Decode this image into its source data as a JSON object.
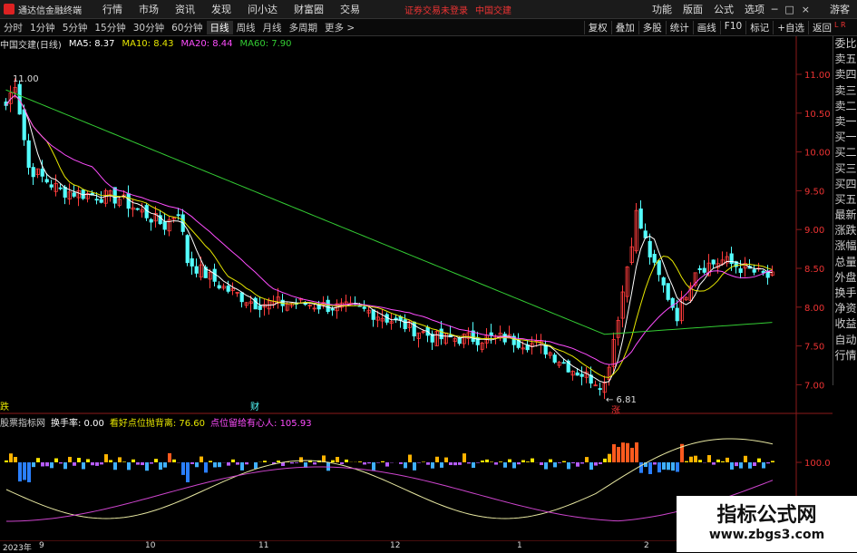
{
  "app": {
    "title": "通达信金融终端"
  },
  "menu": [
    "行情",
    "市场",
    "资讯",
    "发现",
    "问小达",
    "财富圈",
    "交易"
  ],
  "warning": "证券交易未登录",
  "stock_name_top": "中国交建",
  "right_menu": [
    "功能",
    "版面",
    "公式",
    "选项"
  ],
  "window_controls": [
    "─",
    "□",
    "×"
  ],
  "guest": "游客",
  "periods": [
    "分时",
    "1分钟",
    "5分钟",
    "15分钟",
    "30分钟",
    "60分钟",
    "日线",
    "周线",
    "月线",
    "多周期",
    "更多 >"
  ],
  "active_period": "日线",
  "toolbar": [
    "复权",
    "叠加",
    "多股",
    "统计",
    "画线",
    "F10",
    "标记",
    "+自选",
    "返回"
  ],
  "info": {
    "title": "中国交建(日线)",
    "ma5": "MA5: 8.37",
    "ma10": "MA10: 8.43",
    "ma20": "MA20: 8.44",
    "ma60": "MA60: 7.90"
  },
  "right_panel": [
    "委比",
    "卖五",
    "卖四",
    "卖三",
    "卖二",
    "卖一",
    "买一",
    "买二",
    "买三",
    "买四",
    "买五",
    "最新",
    "涨跌",
    "涨幅",
    "总量",
    "外盘",
    "换手",
    "净资",
    "收益",
    "自动",
    "行情"
  ],
  "lr_label": "L R",
  "price_labels": [
    "11.00",
    "10.50",
    "10.00",
    "9.50",
    "9.00",
    "8.50",
    "8.00",
    "7.50",
    "7.00"
  ],
  "annot_high": "11.00",
  "annot_low": "6.81",
  "marker_zhang": "涨",
  "marker_left": "跌",
  "marker_cai": "财",
  "indicator": {
    "name": "股票指标网",
    "turnover": "换手率: 0.00",
    "sell": "看好点位抛背离: 76.60",
    "buy": "点位留给有心人: 105.93",
    "axis": "100.0"
  },
  "date_labels": [
    "2023年",
    "9",
    "10",
    "11",
    "12",
    "1",
    "2"
  ],
  "watermark": {
    "line1": "指标公式网",
    "line2": "www.zbgs3.com"
  },
  "colors": {
    "up": "#ff3c3c",
    "down": "#54ffff",
    "ma5": "#ffffff",
    "ma10": "#e6e600",
    "ma20": "#ff4dff",
    "ma60": "#33cc33"
  }
}
